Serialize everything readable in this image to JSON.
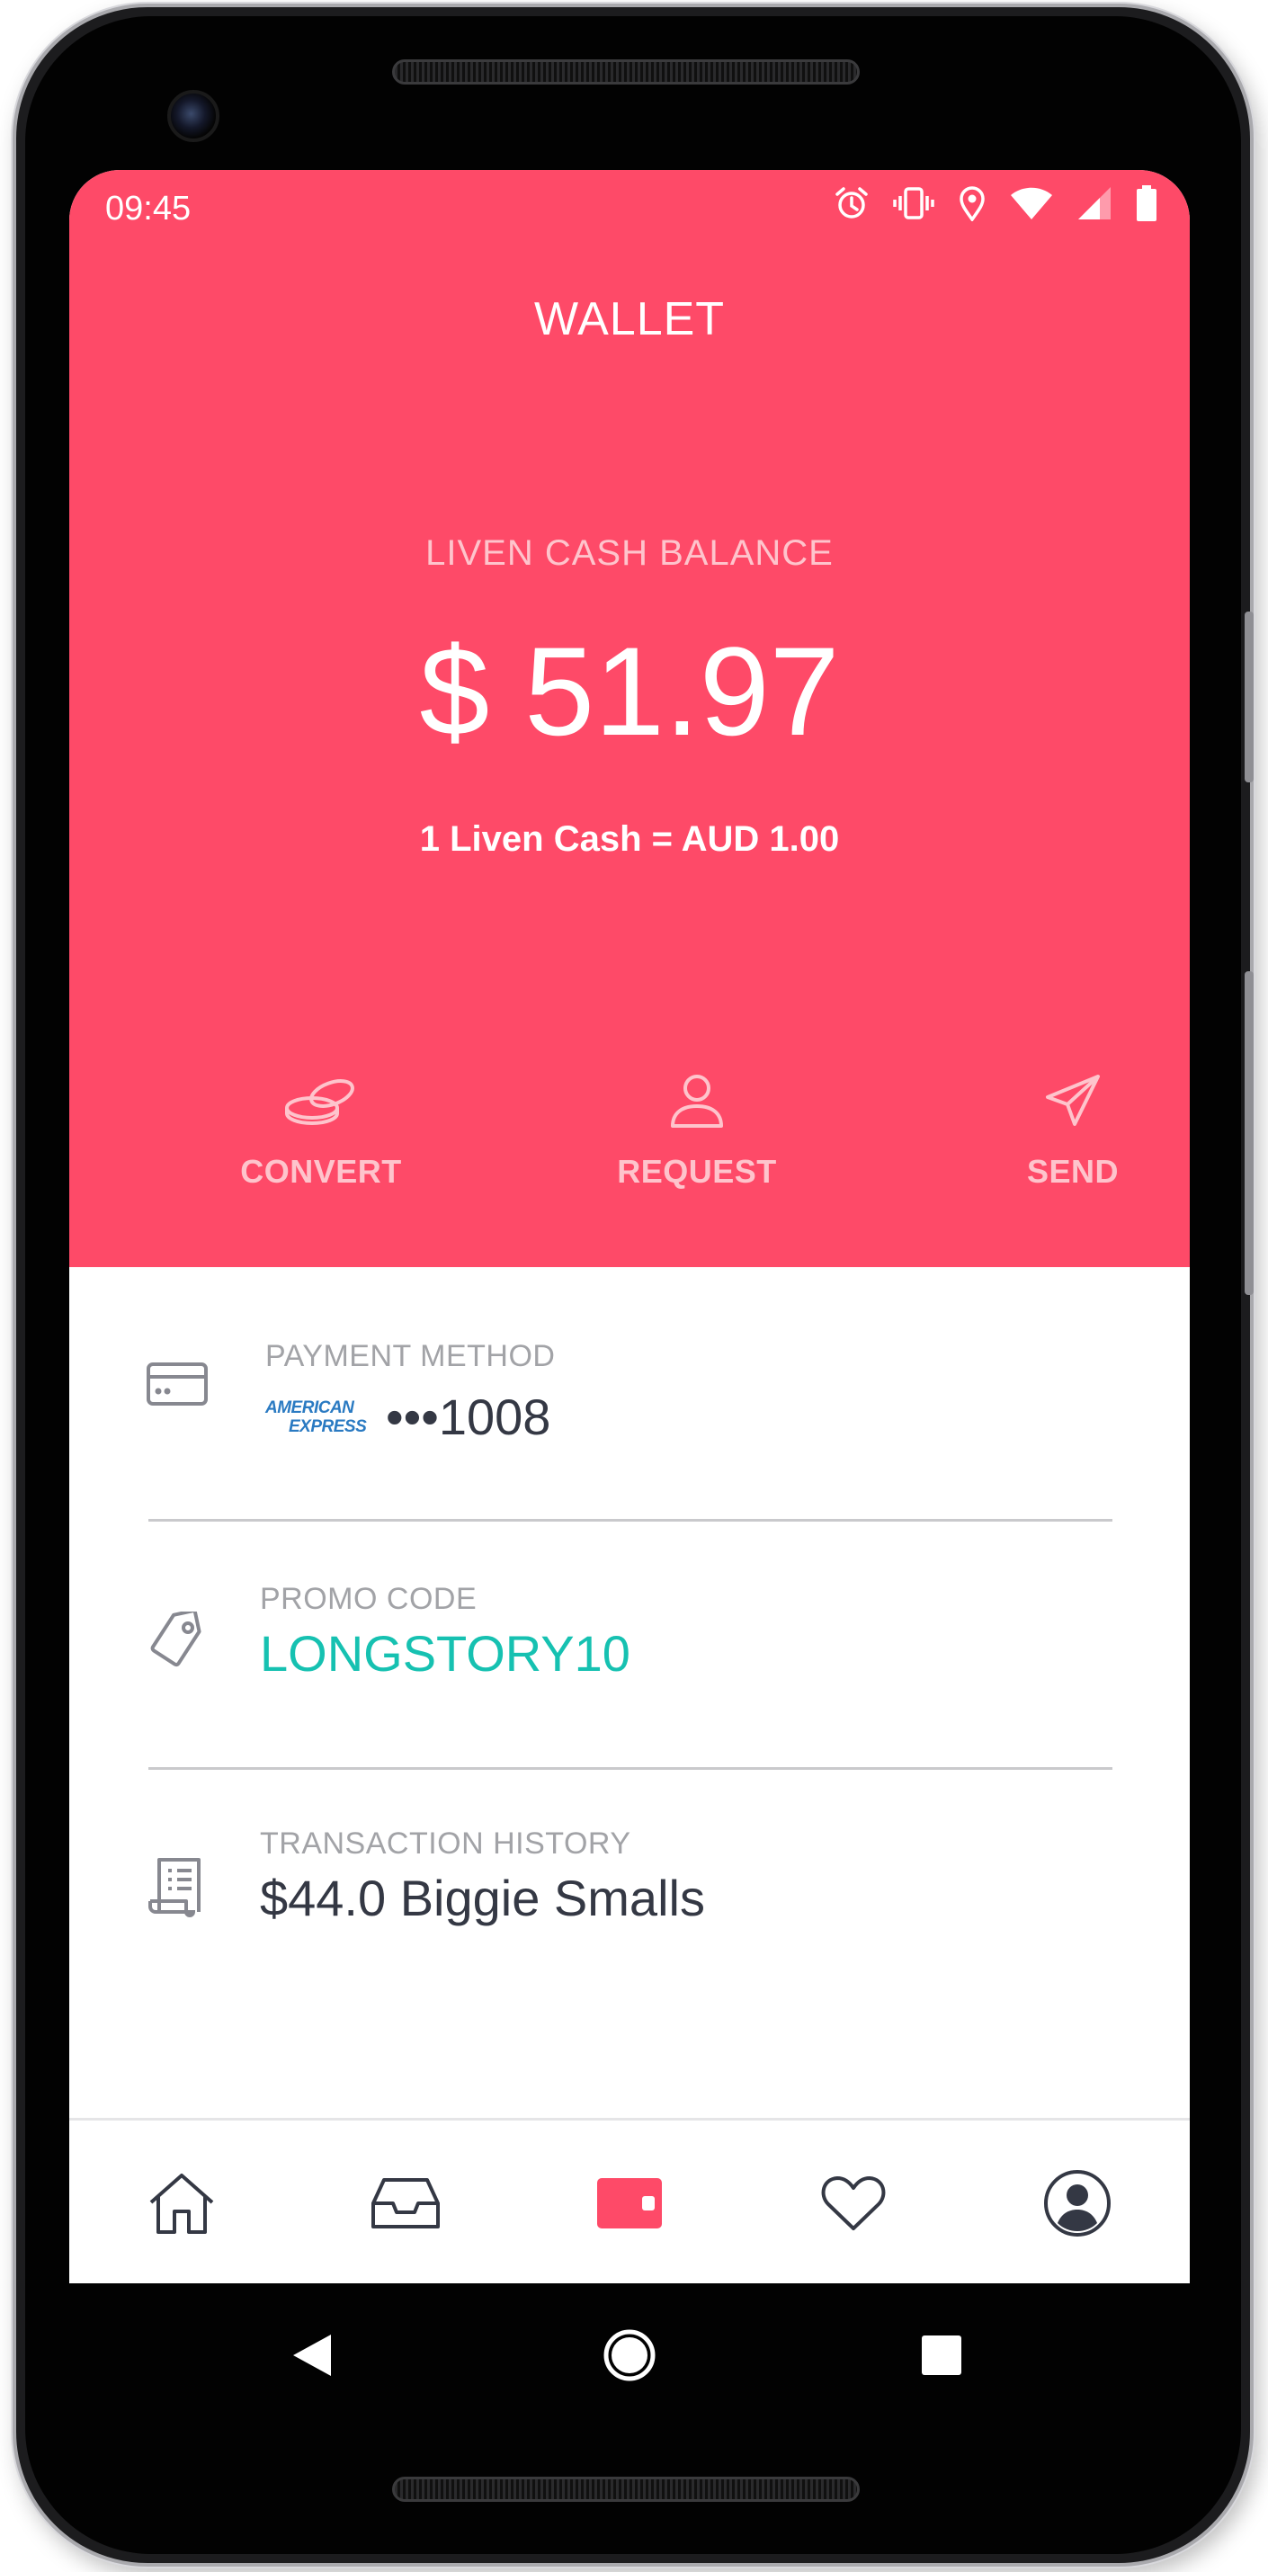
{
  "status_bar": {
    "time": "09:45",
    "icons": [
      "alarm-icon",
      "vibrate-icon",
      "location-icon",
      "wifi-icon",
      "signal-icon",
      "battery-icon"
    ]
  },
  "header": {
    "title": "WALLET"
  },
  "balance": {
    "label": "LIVEN CASH BALANCE",
    "amount": "$ 51.97",
    "rate": "1 Liven Cash = AUD 1.00"
  },
  "actions": [
    {
      "label": "CONVERT",
      "icon": "coins-icon"
    },
    {
      "label": "REQUEST",
      "icon": "person-icon"
    },
    {
      "label": "SEND",
      "icon": "paper-plane-icon"
    }
  ],
  "payment": {
    "label": "PAYMENT METHOD",
    "brand_line1": "AMERICAN",
    "brand_line2": "EXPRESS",
    "card_number": "•••1008",
    "icon": "credit-card-icon"
  },
  "promo": {
    "label": "PROMO CODE",
    "value": "LONGSTORY10",
    "icon": "tag-icon"
  },
  "transactions": {
    "label": "TRANSACTION HISTORY",
    "value": "$44.0 Biggie Smalls",
    "icon": "receipt-icon"
  },
  "bottom_nav": [
    {
      "name": "home",
      "icon": "home-icon",
      "active": false
    },
    {
      "name": "inbox",
      "icon": "inbox-icon",
      "active": false
    },
    {
      "name": "wallet",
      "icon": "wallet-icon",
      "active": true
    },
    {
      "name": "favorites",
      "icon": "heart-icon",
      "active": false
    },
    {
      "name": "profile",
      "icon": "profile-icon",
      "active": false
    }
  ],
  "system_nav": [
    "back-icon",
    "home-circle-icon",
    "recents-icon"
  ],
  "colors": {
    "accent": "#fe4a68",
    "accent_light_text": "#fec4cc",
    "promo_teal": "#16c1b1",
    "dark_text": "#343844",
    "muted_text": "#a2a3a7",
    "amex_blue": "#2a7ac2"
  }
}
